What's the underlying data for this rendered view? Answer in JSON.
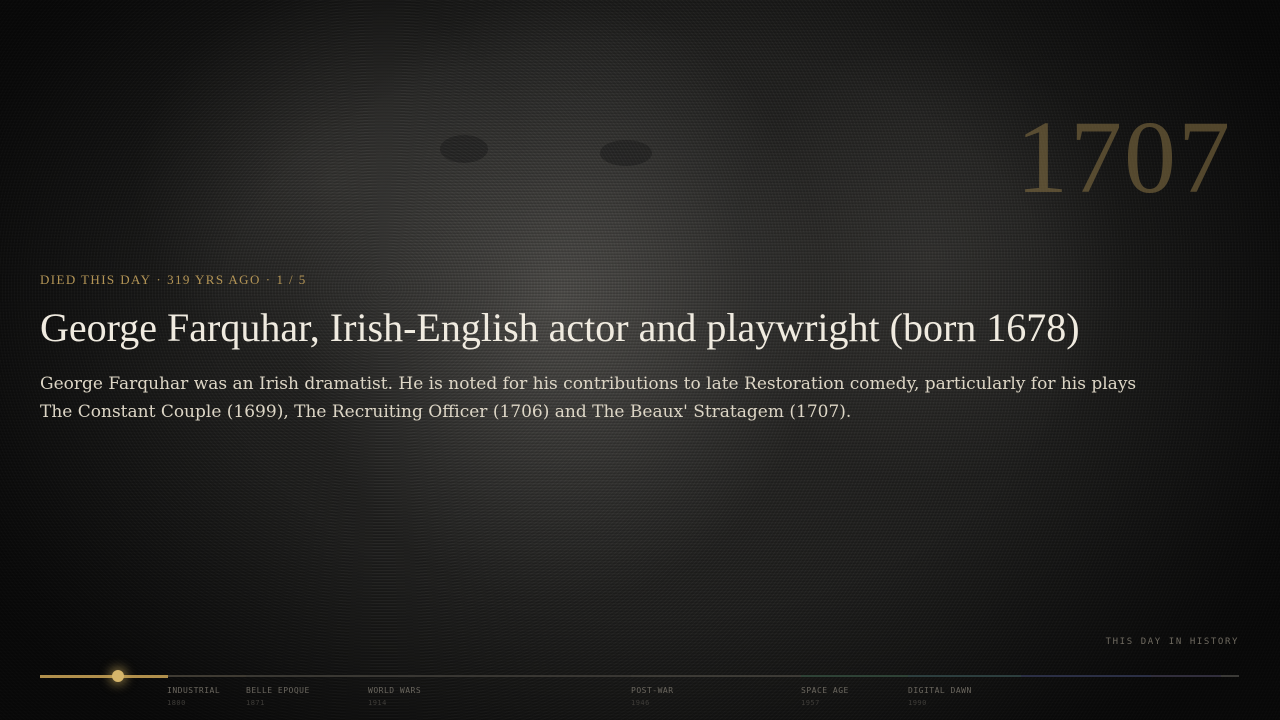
{
  "hero": {
    "year_watermark": "1707",
    "eyebrow": {
      "kind": "DIED THIS DAY",
      "ago": "319 YRS AGO",
      "position": "1 / 5"
    },
    "title": "George Farquhar, Irish-English actor and playwright (born 1678)",
    "description": "George Farquhar was an Irish dramatist. He is noted for his contributions to late Restoration comedy, particularly for his plays The Constant Couple (1699), The Recruiting Officer (1706) and The Beaux' Stratagem (1707)."
  },
  "brand": "THIS DAY IN HISTORY",
  "timeline": {
    "progress_fraction": 0.107,
    "eras": [
      {
        "label": "INDUSTRIAL",
        "year": "1800"
      },
      {
        "label": "BELLE EPOQUE",
        "year": "1871"
      },
      {
        "label": "WORLD WARS",
        "year": "1914"
      },
      {
        "label": "POST-WAR",
        "year": "1946"
      },
      {
        "label": "SPACE AGE",
        "year": "1957"
      },
      {
        "label": "DIGITAL DAWN",
        "year": "1990"
      }
    ]
  },
  "colors": {
    "accent_gold": "#b49556",
    "title": "#f0ebe0"
  }
}
